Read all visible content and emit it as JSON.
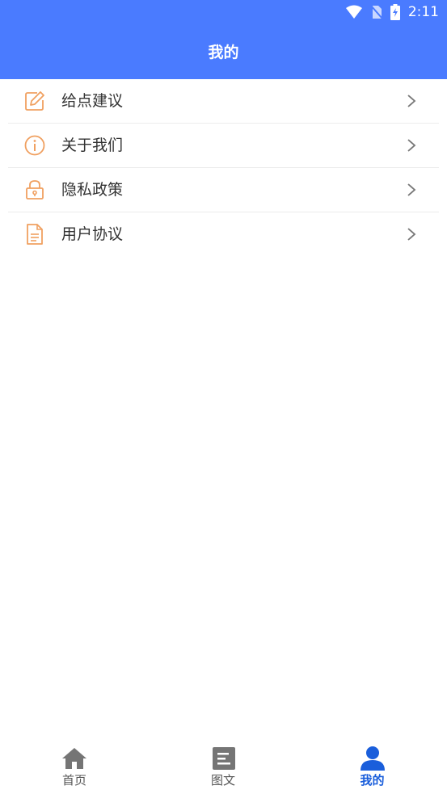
{
  "status_bar": {
    "time": "2:11"
  },
  "header": {
    "title": "我的"
  },
  "menu": [
    {
      "label": "给点建议",
      "icon": "edit-icon"
    },
    {
      "label": "关于我们",
      "icon": "info-icon"
    },
    {
      "label": "隐私政策",
      "icon": "lock-icon"
    },
    {
      "label": "用户协议",
      "icon": "document-icon"
    }
  ],
  "tabbar": [
    {
      "label": "首页",
      "icon": "home-icon",
      "active": false
    },
    {
      "label": "图文",
      "icon": "article-icon",
      "active": false
    },
    {
      "label": "我的",
      "icon": "user-icon",
      "active": true
    }
  ],
  "colors": {
    "header_bg": "#4A7BFF",
    "icon_orange": "#F0A060",
    "tab_active": "#1A5EDB",
    "tab_inactive": "#757575"
  }
}
